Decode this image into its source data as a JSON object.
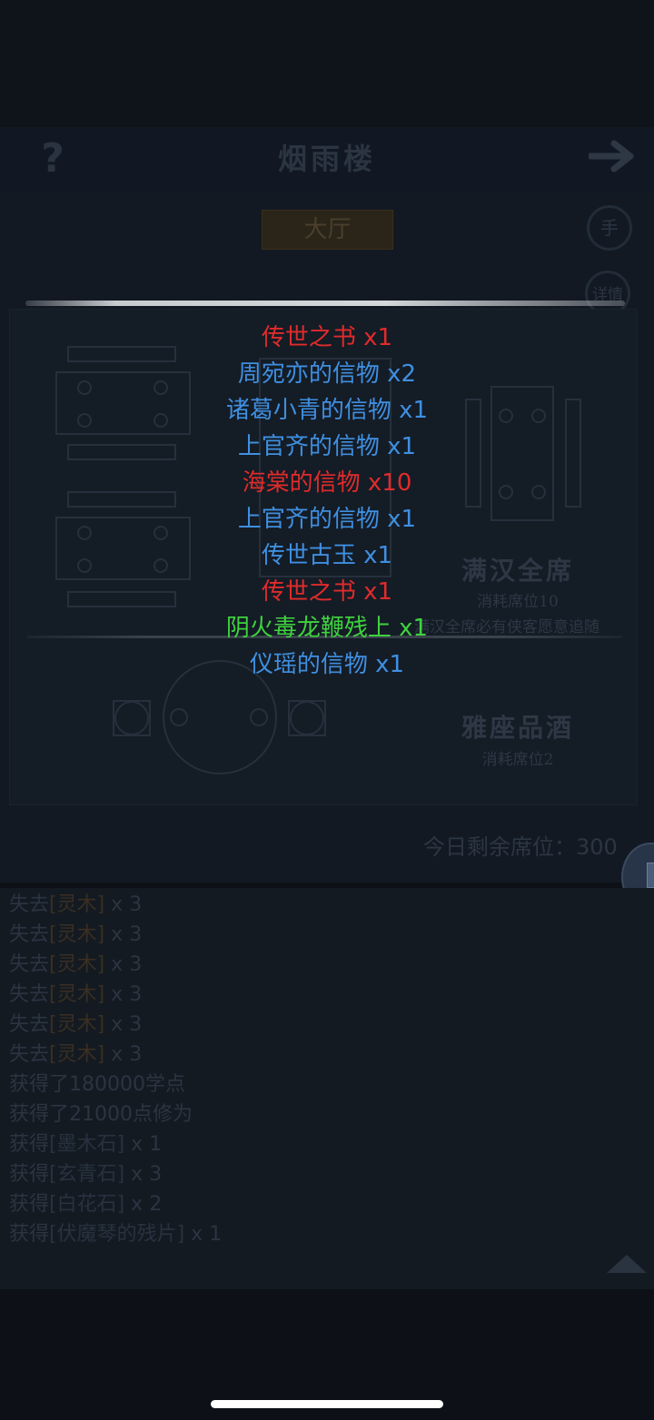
{
  "header": {
    "title": "烟雨楼",
    "help_icon": "?"
  },
  "tabs": {
    "hall": "大厅"
  },
  "buttons": {
    "hand": "手",
    "detail": "详情"
  },
  "seats": {
    "full": {
      "title": "满汉全席",
      "cost": "消耗席位10",
      "note": "满汉全席必有侠客愿意追随"
    },
    "wine": {
      "title": "雅座品酒",
      "cost": "消耗席位2"
    }
  },
  "remaining_seats": "今日剩余席位：300",
  "rewards": [
    {
      "name": "传世之书",
      "qty": "x1",
      "color": "#e02b2b"
    },
    {
      "name": "周宛亦的信物",
      "qty": "x2",
      "color": "#3f8fe0"
    },
    {
      "name": "诸葛小青的信物",
      "qty": "x1",
      "color": "#3f8fe0"
    },
    {
      "name": "上官齐的信物",
      "qty": "x1",
      "color": "#3f8fe0"
    },
    {
      "name": "海棠的信物",
      "qty": "x10",
      "color": "#e02b2b"
    },
    {
      "name": "上官齐的信物",
      "qty": "x1",
      "color": "#3f8fe0"
    },
    {
      "name": "传世古玉",
      "qty": "x1",
      "color": "#3f8fe0"
    },
    {
      "name": "传世之书",
      "qty": "x1",
      "color": "#e02b2b"
    },
    {
      "name": "阴火毒龙鞭残上",
      "qty": "x1",
      "color": "#3fd23f"
    },
    {
      "name": "仪瑶的信物",
      "qty": "x1",
      "color": "#3f8fe0"
    }
  ],
  "log": [
    {
      "prefix": "失去",
      "item": "[灵木]",
      "suffix": " x 3"
    },
    {
      "prefix": "失去",
      "item": "[灵木]",
      "suffix": " x 3"
    },
    {
      "prefix": "失去",
      "item": "[灵木]",
      "suffix": " x 3"
    },
    {
      "prefix": "失去",
      "item": "[灵木]",
      "suffix": " x 3"
    },
    {
      "prefix": "失去",
      "item": "[灵木]",
      "suffix": " x 3"
    },
    {
      "prefix": "失去",
      "item": "[灵木]",
      "suffix": " x 3"
    },
    {
      "prefix": "获得了180000学点",
      "item": "",
      "suffix": ""
    },
    {
      "prefix": "获得了21000点修为",
      "item": "",
      "suffix": ""
    },
    {
      "prefix": "获得",
      "item": "[墨木石]",
      "suffix": " x 1"
    },
    {
      "prefix": "获得",
      "item": "[玄青石]",
      "suffix": " x 3"
    },
    {
      "prefix": "获得",
      "item": "[白花石]",
      "suffix": " x 2"
    },
    {
      "prefix": "获得",
      "item": "[伏魔琴的残片]",
      "suffix": " x 1"
    }
  ]
}
